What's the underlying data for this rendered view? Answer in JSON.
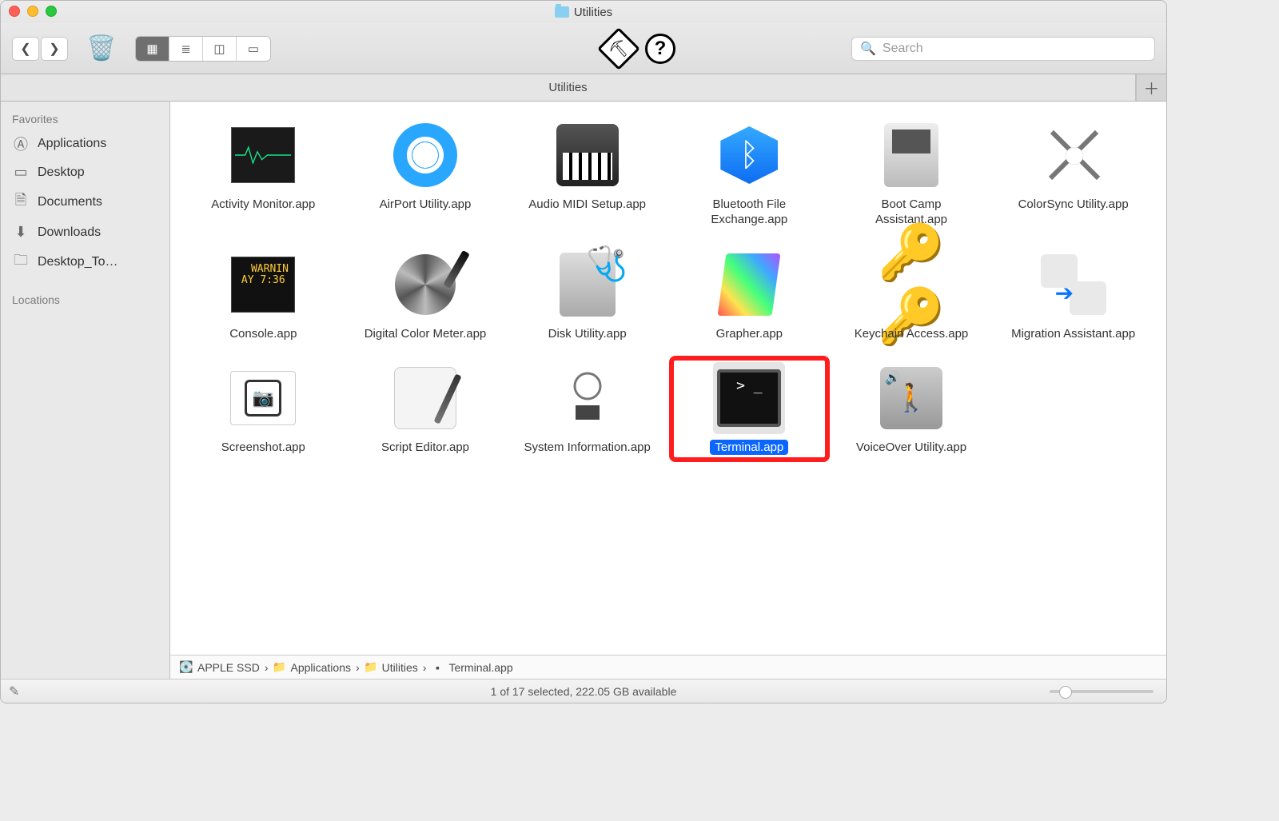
{
  "window": {
    "title": "Utilities"
  },
  "search": {
    "placeholder": "Search"
  },
  "tabbar": {
    "active_label": "Utilities"
  },
  "sidebar": {
    "sections": [
      {
        "header": "Favorites",
        "items": [
          {
            "icon": "apps-icon",
            "label": "Applications"
          },
          {
            "icon": "desktop-icon",
            "label": "Desktop"
          },
          {
            "icon": "documents-icon",
            "label": "Documents"
          },
          {
            "icon": "downloads-icon",
            "label": "Downloads"
          },
          {
            "icon": "folder-icon",
            "label": "Desktop_To…"
          }
        ]
      },
      {
        "header": "Locations",
        "items": []
      }
    ]
  },
  "grid": {
    "items": [
      {
        "label": "Activity Monitor.app",
        "icon": "activity",
        "selected": false
      },
      {
        "label": "AirPort Utility.app",
        "icon": "airport",
        "selected": false
      },
      {
        "label": "Audio MIDI Setup.app",
        "icon": "midi",
        "selected": false
      },
      {
        "label": "Bluetooth File Exchange.app",
        "icon": "bt",
        "selected": false
      },
      {
        "label": "Boot Camp Assistant.app",
        "icon": "bootcamp",
        "selected": false
      },
      {
        "label": "ColorSync Utility.app",
        "icon": "colorsync",
        "selected": false
      },
      {
        "label": "Console.app",
        "icon": "console",
        "selected": false
      },
      {
        "label": "Digital Color Meter.app",
        "icon": "dcm",
        "selected": false
      },
      {
        "label": "Disk Utility.app",
        "icon": "disk",
        "selected": false
      },
      {
        "label": "Grapher.app",
        "icon": "grapher",
        "selected": false
      },
      {
        "label": "Keychain Access.app",
        "icon": "keychain",
        "selected": false
      },
      {
        "label": "Migration Assistant.app",
        "icon": "migration",
        "selected": false
      },
      {
        "label": "Screenshot.app",
        "icon": "screenshot",
        "selected": false
      },
      {
        "label": "Script Editor.app",
        "icon": "script",
        "selected": false
      },
      {
        "label": "System Information.app",
        "icon": "sysinfo",
        "selected": false
      },
      {
        "label": "Terminal.app",
        "icon": "terminal",
        "selected": true,
        "highlight": true
      },
      {
        "label": "VoiceOver Utility.app",
        "icon": "voiceover",
        "selected": false
      }
    ]
  },
  "console_text": "  WARNIN\nAY 7:36",
  "pathbar": {
    "crumbs": [
      {
        "icon": "disk-mini",
        "label": "APPLE SSD"
      },
      {
        "icon": "folder-mini",
        "label": "Applications"
      },
      {
        "icon": "folder-mini",
        "label": "Utilities"
      },
      {
        "icon": "app-mini",
        "label": "Terminal.app"
      }
    ],
    "separator": "›"
  },
  "status": {
    "text": "1 of 17 selected, 222.05 GB available"
  }
}
